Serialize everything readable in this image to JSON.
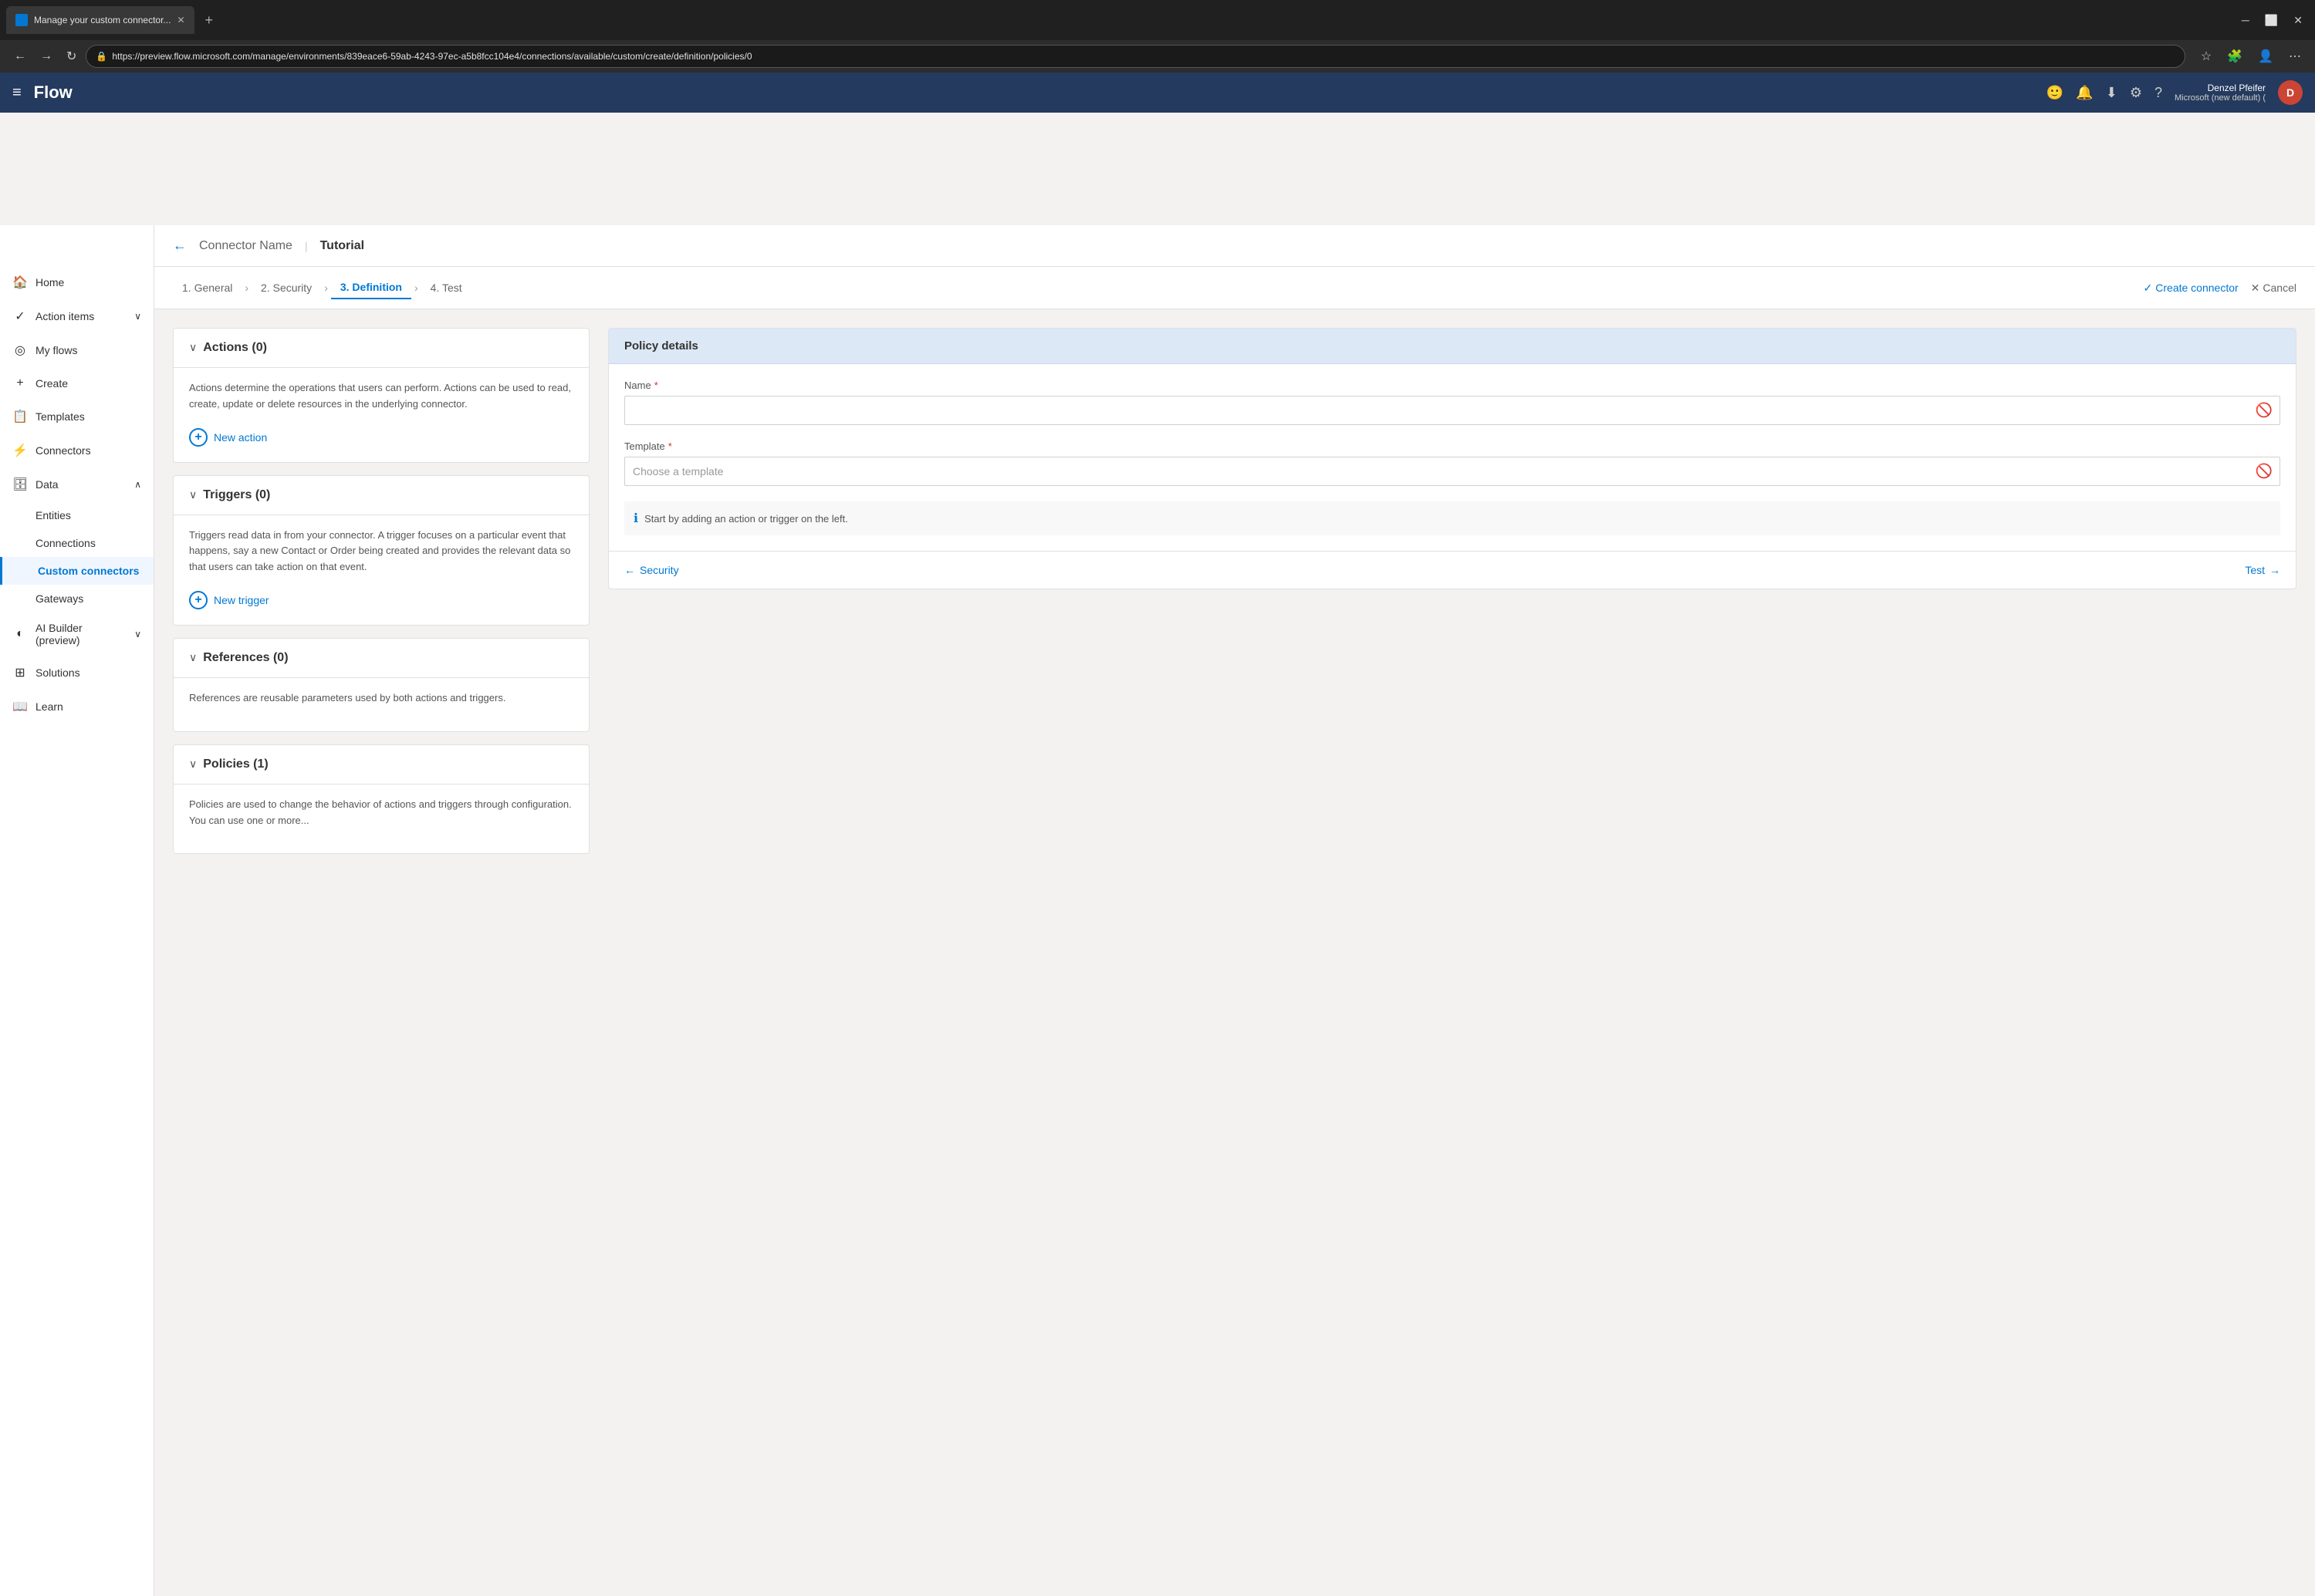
{
  "browser": {
    "tab_title": "Manage your custom connector...",
    "url": "https://preview.flow.microsoft.com/manage/environments/839eace6-59ab-4243-97ec-a5b8fcc104e4/connections/available/custom/create/definition/policies/0",
    "new_tab": "+",
    "back": "←",
    "forward": "→",
    "refresh": "↻",
    "window_controls": {
      "minimize": "─",
      "maximize": "⬜",
      "close": "✕"
    }
  },
  "topnav": {
    "hamburger": "≡",
    "logo": "Flow",
    "user_name": "Denzel Pfeifer",
    "user_org": "Microsoft (new default) (",
    "user_initial": "D"
  },
  "sidebar": {
    "items": [
      {
        "id": "home",
        "icon": "🏠",
        "label": "Home"
      },
      {
        "id": "action-items",
        "icon": "✓",
        "label": "Action items",
        "chevron": "∨"
      },
      {
        "id": "my-flows",
        "icon": "◎",
        "label": "My flows"
      },
      {
        "id": "create",
        "icon": "+",
        "label": "Create"
      },
      {
        "id": "templates",
        "icon": "📋",
        "label": "Templates"
      },
      {
        "id": "connectors",
        "icon": "⚡",
        "label": "Connectors"
      },
      {
        "id": "data",
        "icon": "🗄",
        "label": "Data",
        "chevron": "∧"
      },
      {
        "id": "entities",
        "label": "Entities",
        "sub": true
      },
      {
        "id": "connections",
        "label": "Connections",
        "sub": true
      },
      {
        "id": "custom-connectors",
        "label": "Custom connectors",
        "sub": true,
        "active": true
      },
      {
        "id": "gateways",
        "label": "Gateways",
        "sub": true
      },
      {
        "id": "ai-builder",
        "icon": "◐",
        "label": "AI Builder\n(preview)",
        "chevron": "∨"
      },
      {
        "id": "solutions",
        "icon": "⊞",
        "label": "Solutions"
      },
      {
        "id": "learn",
        "icon": "📖",
        "label": "Learn"
      }
    ]
  },
  "header": {
    "back_icon": "←",
    "connector_name": "Connector Name",
    "separator": "|",
    "tutorial": "Tutorial"
  },
  "steps": [
    {
      "id": "general",
      "label": "1. General"
    },
    {
      "id": "security",
      "label": "2. Security"
    },
    {
      "id": "definition",
      "label": "3. Definition",
      "active": true
    },
    {
      "id": "test",
      "label": "4. Test"
    }
  ],
  "actions": {
    "create_connector": "Create connector",
    "cancel": "Cancel",
    "check_icon": "✓",
    "x_icon": "✕"
  },
  "sections": [
    {
      "id": "actions",
      "title": "Actions (0)",
      "desc": "Actions determine the operations that users can perform. Actions can be used to read, create, update or delete resources in the underlying connector.",
      "new_btn": "New action"
    },
    {
      "id": "triggers",
      "title": "Triggers (0)",
      "desc": "Triggers read data in from your connector. A trigger focuses on a particular event that happens, say a new Contact or Order being created and provides the relevant data so that users can take action on that event.",
      "new_btn": "New trigger"
    },
    {
      "id": "references",
      "title": "References (0)",
      "desc": "References are reusable parameters used by both actions and triggers.",
      "new_btn": null
    },
    {
      "id": "policies",
      "title": "Policies (1)",
      "desc": "Policies are used to change the behavior of actions and triggers through configuration. You can use one or more...",
      "new_btn": null
    }
  ],
  "policy_details": {
    "header": "Policy details",
    "name_label": "Name",
    "name_required": "*",
    "name_value": "",
    "template_label": "Template",
    "template_required": "*",
    "template_placeholder": "Choose a template",
    "info_msg": "Start by adding an action or trigger on the left.",
    "nav_back": "Security",
    "nav_forward": "Test"
  }
}
